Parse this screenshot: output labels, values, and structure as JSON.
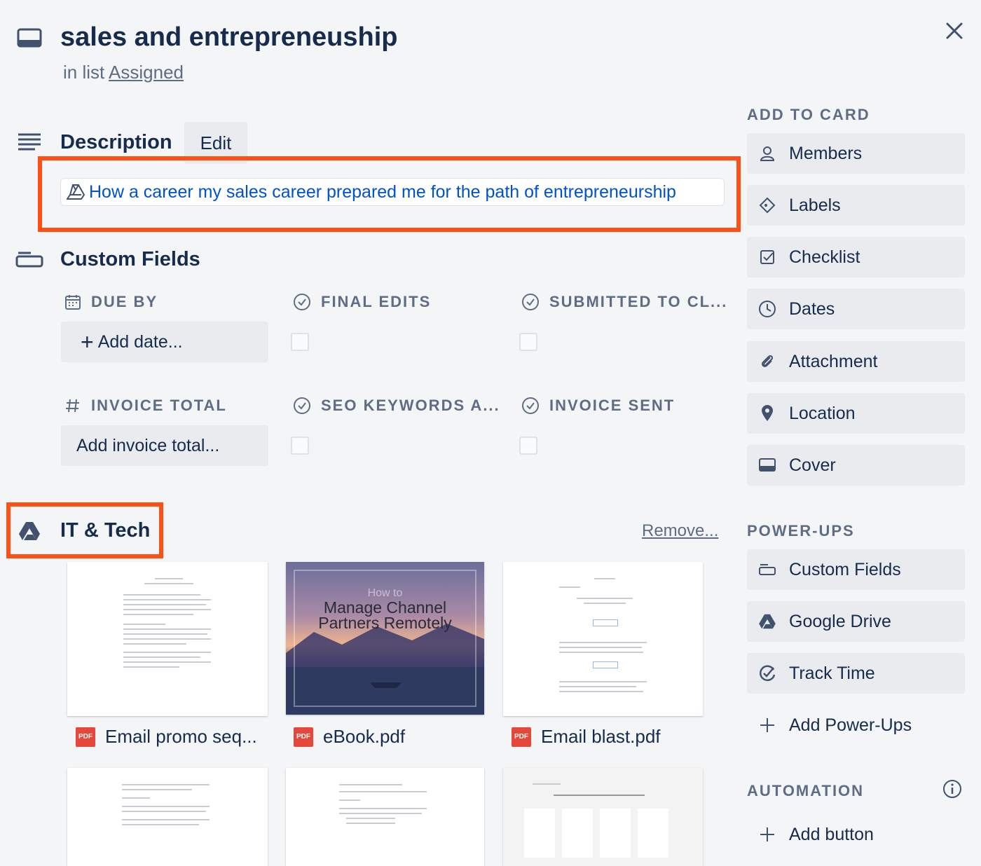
{
  "header": {
    "title": "sales and entrepreneuship",
    "list_prefix": "in list",
    "list_name": "Assigned"
  },
  "description": {
    "heading": "Description",
    "edit_label": "Edit",
    "link_text": "How a career my sales career prepared me for the path of entrepreneurship"
  },
  "custom_fields": {
    "heading": "Custom Fields",
    "fields": [
      {
        "label": "DUE BY",
        "value": "Add date..."
      },
      {
        "label": "FINAL EDITS"
      },
      {
        "label": "SUBMITTED TO CL..."
      },
      {
        "label": "INVOICE TOTAL",
        "value": "Add invoice total..."
      },
      {
        "label": "SEO KEYWORDS A..."
      },
      {
        "label": "INVOICE SENT"
      }
    ]
  },
  "drive": {
    "heading": "IT & Tech",
    "remove_label": "Remove...",
    "files": [
      {
        "name": "Email promo seq..."
      },
      {
        "name": "eBook.pdf",
        "thumb_title": "Manage Channel Partners Remotely",
        "thumb_faded": "How to"
      },
      {
        "name": "Email blast.pdf"
      }
    ],
    "pdf_badge": "PDF"
  },
  "sidebar": {
    "add_to_card": {
      "heading": "ADD TO CARD",
      "items": [
        {
          "label": "Members",
          "icon": "person-icon"
        },
        {
          "label": "Labels",
          "icon": "tag-icon"
        },
        {
          "label": "Checklist",
          "icon": "checklist-icon"
        },
        {
          "label": "Dates",
          "icon": "clock-icon"
        },
        {
          "label": "Attachment",
          "icon": "paperclip-icon"
        },
        {
          "label": "Location",
          "icon": "pin-icon"
        },
        {
          "label": "Cover",
          "icon": "cover-icon"
        }
      ]
    },
    "power_ups": {
      "heading": "POWER-UPS",
      "items": [
        {
          "label": "Custom Fields",
          "icon": "custom-fields-icon"
        },
        {
          "label": "Google Drive",
          "icon": "google-drive-icon"
        },
        {
          "label": "Track Time",
          "icon": "track-time-icon"
        },
        {
          "label": "Add Power-Ups",
          "icon": "plus-icon"
        }
      ]
    },
    "automation": {
      "heading": "AUTOMATION",
      "items": [
        {
          "label": "Add button",
          "icon": "plus-icon"
        }
      ]
    }
  },
  "colors": {
    "highlight": "#ff4f14",
    "link": "#0052cc",
    "pdf": "#e5483a"
  }
}
